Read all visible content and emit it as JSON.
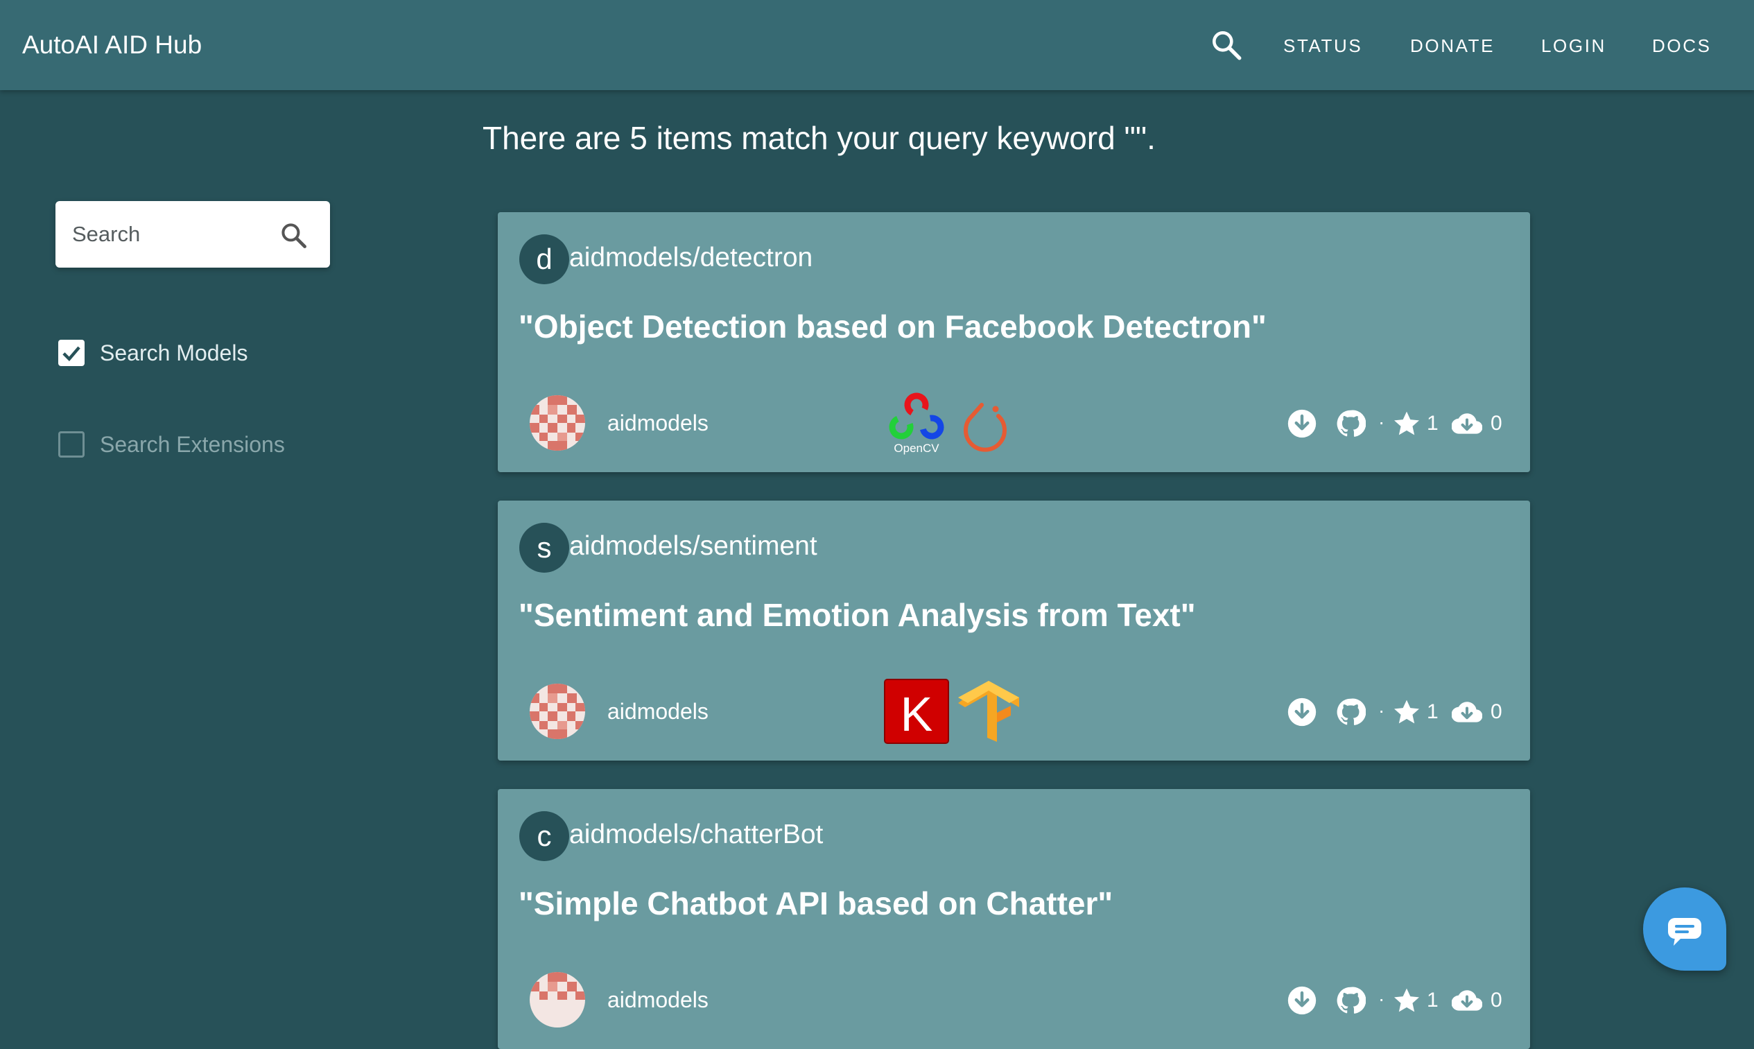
{
  "app": {
    "title": "AutoAI AID Hub"
  },
  "nav": {
    "search_icon": "search-icon",
    "items": [
      {
        "label": "STATUS"
      },
      {
        "label": "DONATE"
      },
      {
        "label": "LOGIN"
      },
      {
        "label": "DOCS"
      }
    ]
  },
  "results": {
    "title": "There are 5 items match your query keyword \"\"."
  },
  "sidebar": {
    "search": {
      "placeholder": "Search",
      "value": ""
    },
    "filters": [
      {
        "label": "Search Models",
        "checked": true
      },
      {
        "label": "Search Extensions",
        "checked": false
      }
    ]
  },
  "cards": [
    {
      "avatar_letter": "d",
      "repo": "aidmodels/detectron",
      "description": "\"Object Detection based on Facebook Detectron\"",
      "owner": "aidmodels",
      "frameworks": [
        "opencv-logo",
        "pytorch-logo"
      ],
      "framework_labels": [
        "OpenCV"
      ],
      "stars": "1",
      "downloads": "0"
    },
    {
      "avatar_letter": "s",
      "repo": "aidmodels/sentiment",
      "description": "\"Sentiment and Emotion Analysis from Text\"",
      "owner": "aidmodels",
      "frameworks": [
        "keras-logo",
        "tensorflow-logo"
      ],
      "framework_labels": [
        "K"
      ],
      "stars": "1",
      "downloads": "0"
    },
    {
      "avatar_letter": "c",
      "repo": "aidmodels/chatterBot",
      "description": "\"Simple Chatbot API based on Chatter\"",
      "owner": "aidmodels",
      "frameworks": [],
      "framework_labels": [],
      "stars": "1",
      "downloads": "0"
    }
  ],
  "colors": {
    "background": "#275158",
    "appbar": "#376a73",
    "card": "#6a9ba0",
    "chat_fab": "#3c9ae0",
    "keras_red": "#d00000",
    "tf_orange": "#f5a623"
  },
  "chat": {
    "icon": "chat-icon"
  }
}
